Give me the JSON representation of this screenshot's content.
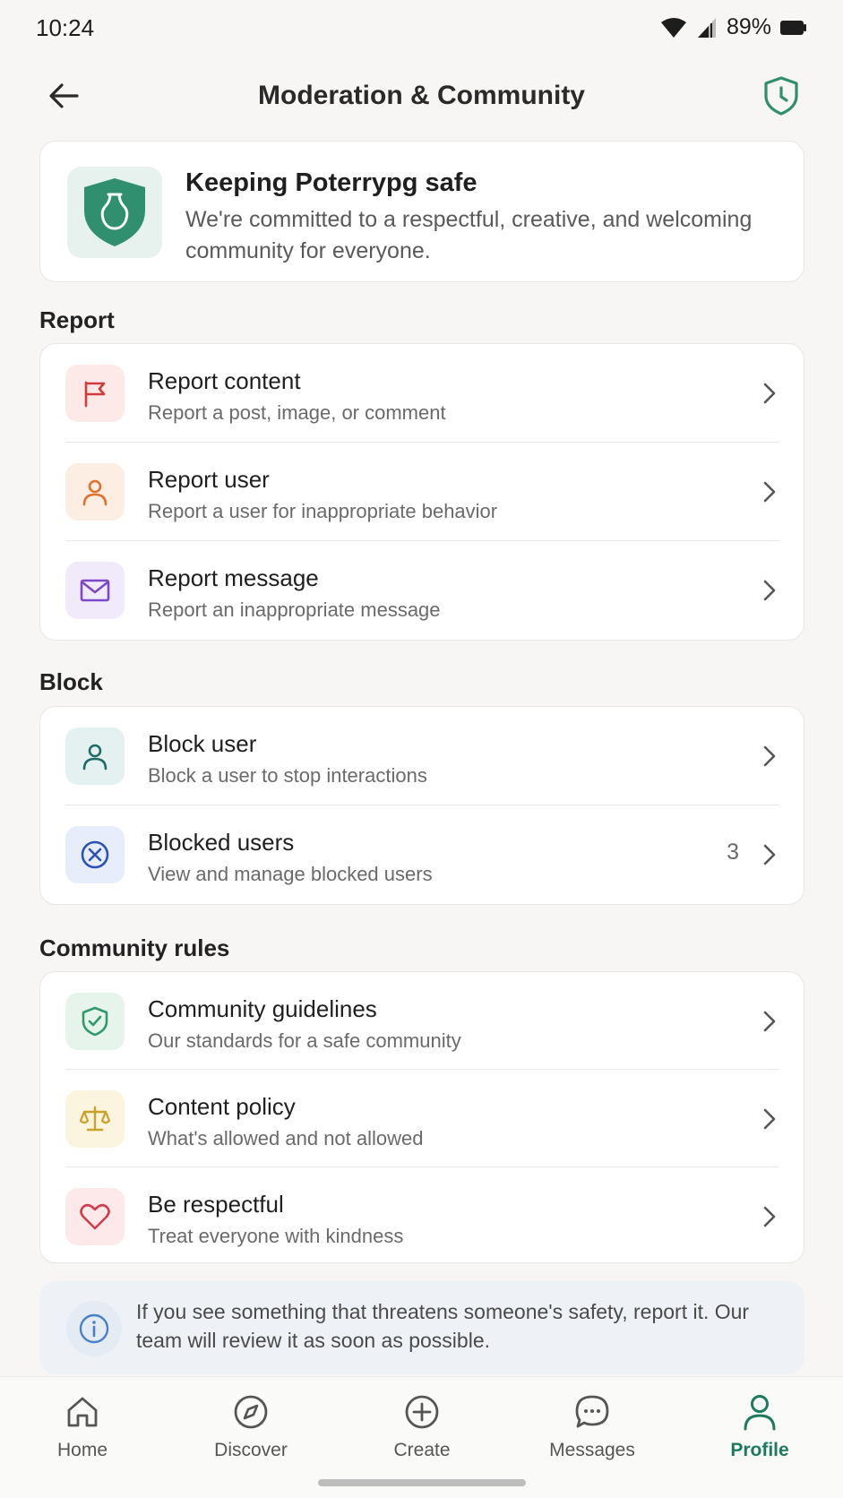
{
  "status_bar": {
    "time": "10:24",
    "battery": "89%"
  },
  "header": {
    "title": "Moderation & Community"
  },
  "hero": {
    "title": "Keeping Poterrypg safe",
    "subtitle": "We're committed to a respectful, creative, and welcoming community for everyone."
  },
  "sections": {
    "report": {
      "title": "Report",
      "items": [
        {
          "label": "Report content",
          "sub": "Report a post, image, or comment",
          "icon": "flag-icon",
          "color": "#d23b3b",
          "bg": "#fde9e8"
        },
        {
          "label": "Report user",
          "sub": "Report a user for inappropriate behavior",
          "icon": "user-icon",
          "color": "#e0702a",
          "bg": "#fdeee3"
        },
        {
          "label": "Report message",
          "sub": "Report an inappropriate message",
          "icon": "mail-icon",
          "color": "#7a48c8",
          "bg": "#f1eafb"
        }
      ]
    },
    "block": {
      "title": "Block",
      "items": [
        {
          "label": "Block user",
          "sub": "Block a user to stop interactions",
          "icon": "user-icon",
          "color": "#1f6b66",
          "bg": "#e4f1f0"
        },
        {
          "label": "Blocked users",
          "sub": "View and manage blocked users",
          "count": "3",
          "icon": "blocked-icon",
          "color": "#2a52b8",
          "bg": "#e7edfa"
        }
      ]
    },
    "rules": {
      "title": "Community rules",
      "items": [
        {
          "label": "Community guidelines",
          "sub": "Our standards for a safe community",
          "icon": "shield-check-icon",
          "color": "#2f9a6a",
          "bg": "#e6f4ec"
        },
        {
          "label": "Content policy",
          "sub": "What's allowed and not allowed",
          "icon": "scale-icon",
          "color": "#c9a227",
          "bg": "#fbf4df"
        },
        {
          "label": "Be respectful",
          "sub": "Treat everyone with kindness",
          "icon": "heart-icon",
          "color": "#d23b4b",
          "bg": "#fde9ea"
        }
      ]
    }
  },
  "info": {
    "text": "If you see something that threatens someone's safety, report it. Our team will review it as soon as possible."
  },
  "nav": {
    "items": [
      {
        "label": "Home",
        "icon": "home-icon"
      },
      {
        "label": "Discover",
        "icon": "compass-icon"
      },
      {
        "label": "Create",
        "icon": "plus-circle-icon"
      },
      {
        "label": "Messages",
        "icon": "chat-icon"
      },
      {
        "label": "Profile",
        "icon": "profile-icon",
        "active": true
      }
    ],
    "active_color": "#1d7a5e"
  },
  "colors": {
    "brand": "#2f8f6f",
    "background": "#f7f6f4"
  }
}
